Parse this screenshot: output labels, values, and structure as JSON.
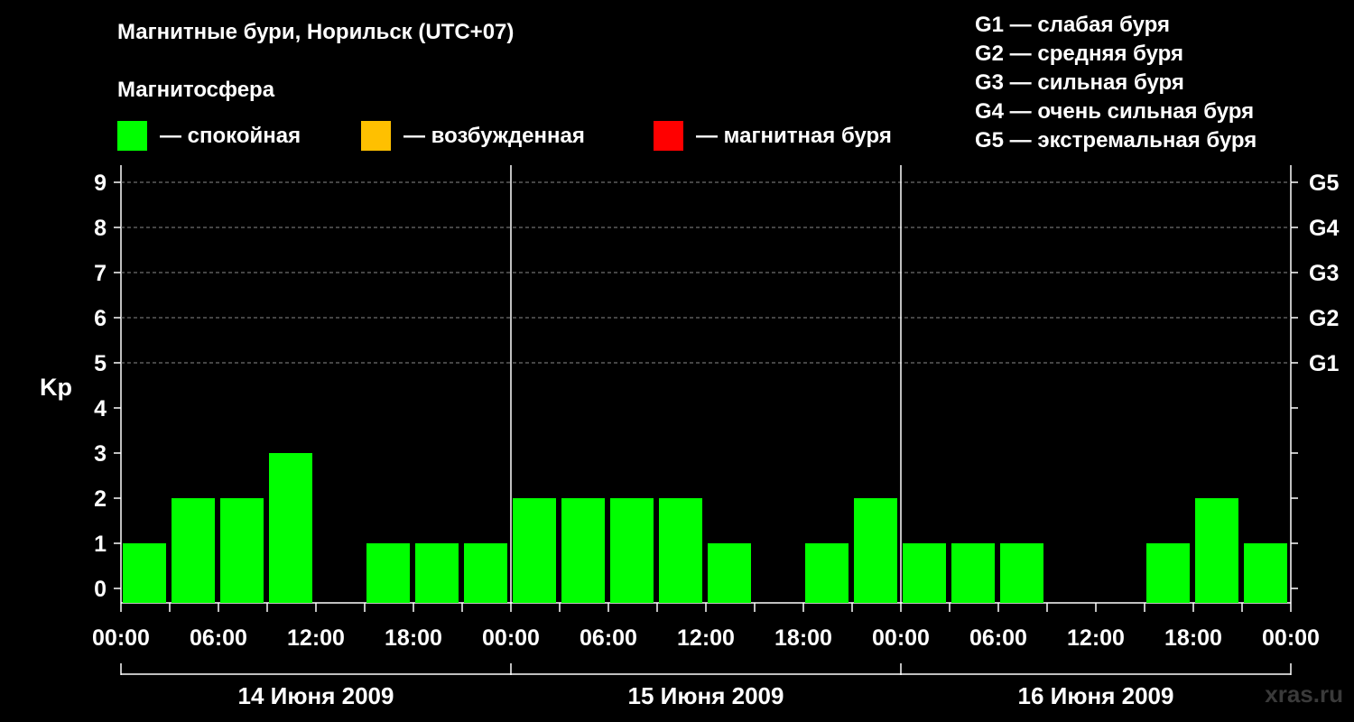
{
  "title": "Магнитные бури, Норильск (UTC+07)",
  "legend": {
    "title": "Магнитосфера",
    "items": [
      {
        "label": "— спокойная",
        "color": "#00ff00"
      },
      {
        "label": "— возбужденная",
        "color": "#ffc000"
      },
      {
        "label": "— магнитная буря",
        "color": "#ff0000"
      }
    ]
  },
  "g_legend": [
    "G1 — слабая буря",
    "G2 — средняя буря",
    "G3 — сильная буря",
    "G4 — очень сильная буря",
    "G5 — экстремальная буря"
  ],
  "watermark": "xras.ru",
  "chart_data": {
    "type": "bar",
    "ylabel": "Kp",
    "ylim": [
      0,
      9
    ],
    "y_ticks": [
      "0",
      "1",
      "2",
      "3",
      "4",
      "5",
      "6",
      "7",
      "8",
      "9"
    ],
    "right_ticks": [
      {
        "value": 5,
        "label": "G1"
      },
      {
        "value": 6,
        "label": "G2"
      },
      {
        "value": 7,
        "label": "G3"
      },
      {
        "value": 8,
        "label": "G4"
      },
      {
        "value": 9,
        "label": "G5"
      }
    ],
    "x_tick_labels": [
      "00:00",
      "06:00",
      "12:00",
      "18:00",
      "00:00",
      "06:00",
      "12:00",
      "18:00",
      "00:00",
      "06:00",
      "12:00",
      "18:00",
      "00:00"
    ],
    "days": [
      "14 Июня 2009",
      "15 Июня 2009",
      "16 Июня 2009"
    ],
    "interval_hours": 3,
    "grid": "dashed horizontal at 5-9",
    "series": [
      {
        "values": [
          1,
          2,
          2,
          3,
          0,
          1,
          1,
          1,
          2,
          2,
          2,
          2,
          1,
          0,
          1,
          2,
          1,
          1,
          1,
          0,
          0,
          1,
          2,
          1
        ]
      }
    ]
  }
}
